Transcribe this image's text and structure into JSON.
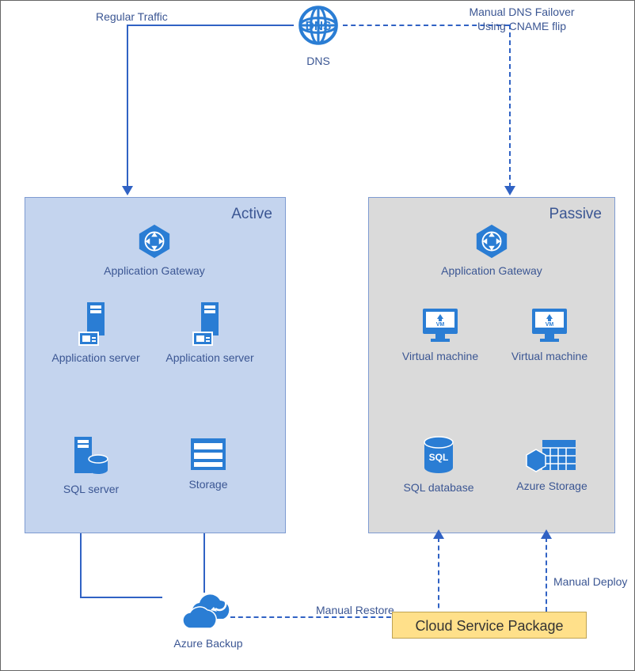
{
  "dns": {
    "label": "DNS",
    "left_label": "Regular Traffic",
    "right_label": "Manual DNS Failover\nUsing CNAME flip"
  },
  "active": {
    "title": "Active",
    "app_gateway": "Application Gateway",
    "app_server_1": "Application server",
    "app_server_2": "Application server",
    "sql_server": "SQL server",
    "storage": "Storage"
  },
  "passive": {
    "title": "Passive",
    "app_gateway": "Application Gateway",
    "vm_1": "Virtual machine",
    "vm_2": "Virtual machine",
    "sql_db": "SQL database",
    "storage": "Azure Storage"
  },
  "backup": {
    "label": "Azure Backup",
    "restore_label": "Manual Restore",
    "deploy_label": "Manual Deploy"
  },
  "cloud_pkg": "Cloud Service Package"
}
